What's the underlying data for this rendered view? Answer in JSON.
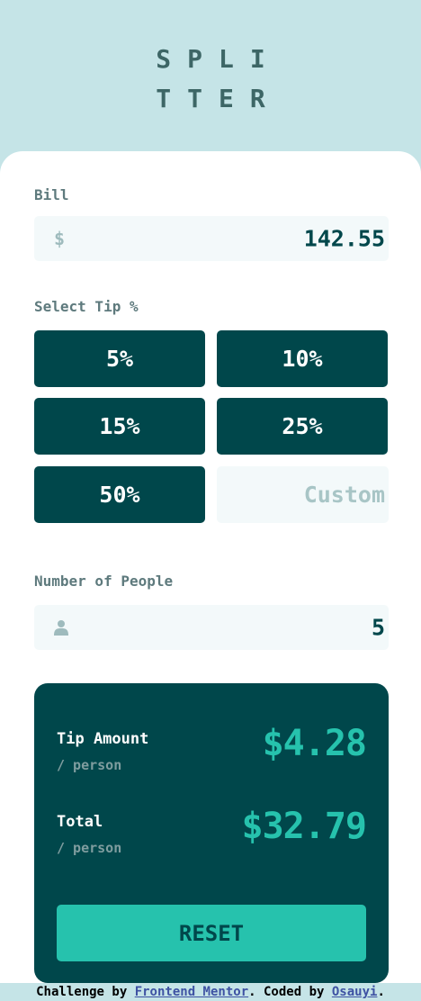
{
  "logo": {
    "line1": "SPLI",
    "line2": "TTER"
  },
  "bill": {
    "label": "Bill",
    "currency_symbol": "$",
    "value": "142.55"
  },
  "tip": {
    "label": "Select Tip %",
    "options": [
      "5%",
      "10%",
      "15%",
      "25%",
      "50%"
    ],
    "custom_placeholder": "Custom"
  },
  "people": {
    "label": "Number of People",
    "icon": "person-icon",
    "value": "5"
  },
  "results": {
    "tip_label": "Tip Amount",
    "tip_sub": "/ person",
    "tip_value": "$4.28",
    "total_label": "Total",
    "total_sub": "/ person",
    "total_value": "$32.79",
    "reset_label": "RESET"
  },
  "attribution": {
    "prefix": "Challenge by ",
    "link1": "Frontend Mentor",
    "middle": ". Coded by ",
    "link2": "Osauyi",
    "suffix": "."
  },
  "colors": {
    "background": "#c5e4e7",
    "dark_cyan": "#00474b",
    "strong_cyan": "#26c2ad",
    "input_bg": "#f3f9fa",
    "label_gray": "#5e7a7d"
  }
}
